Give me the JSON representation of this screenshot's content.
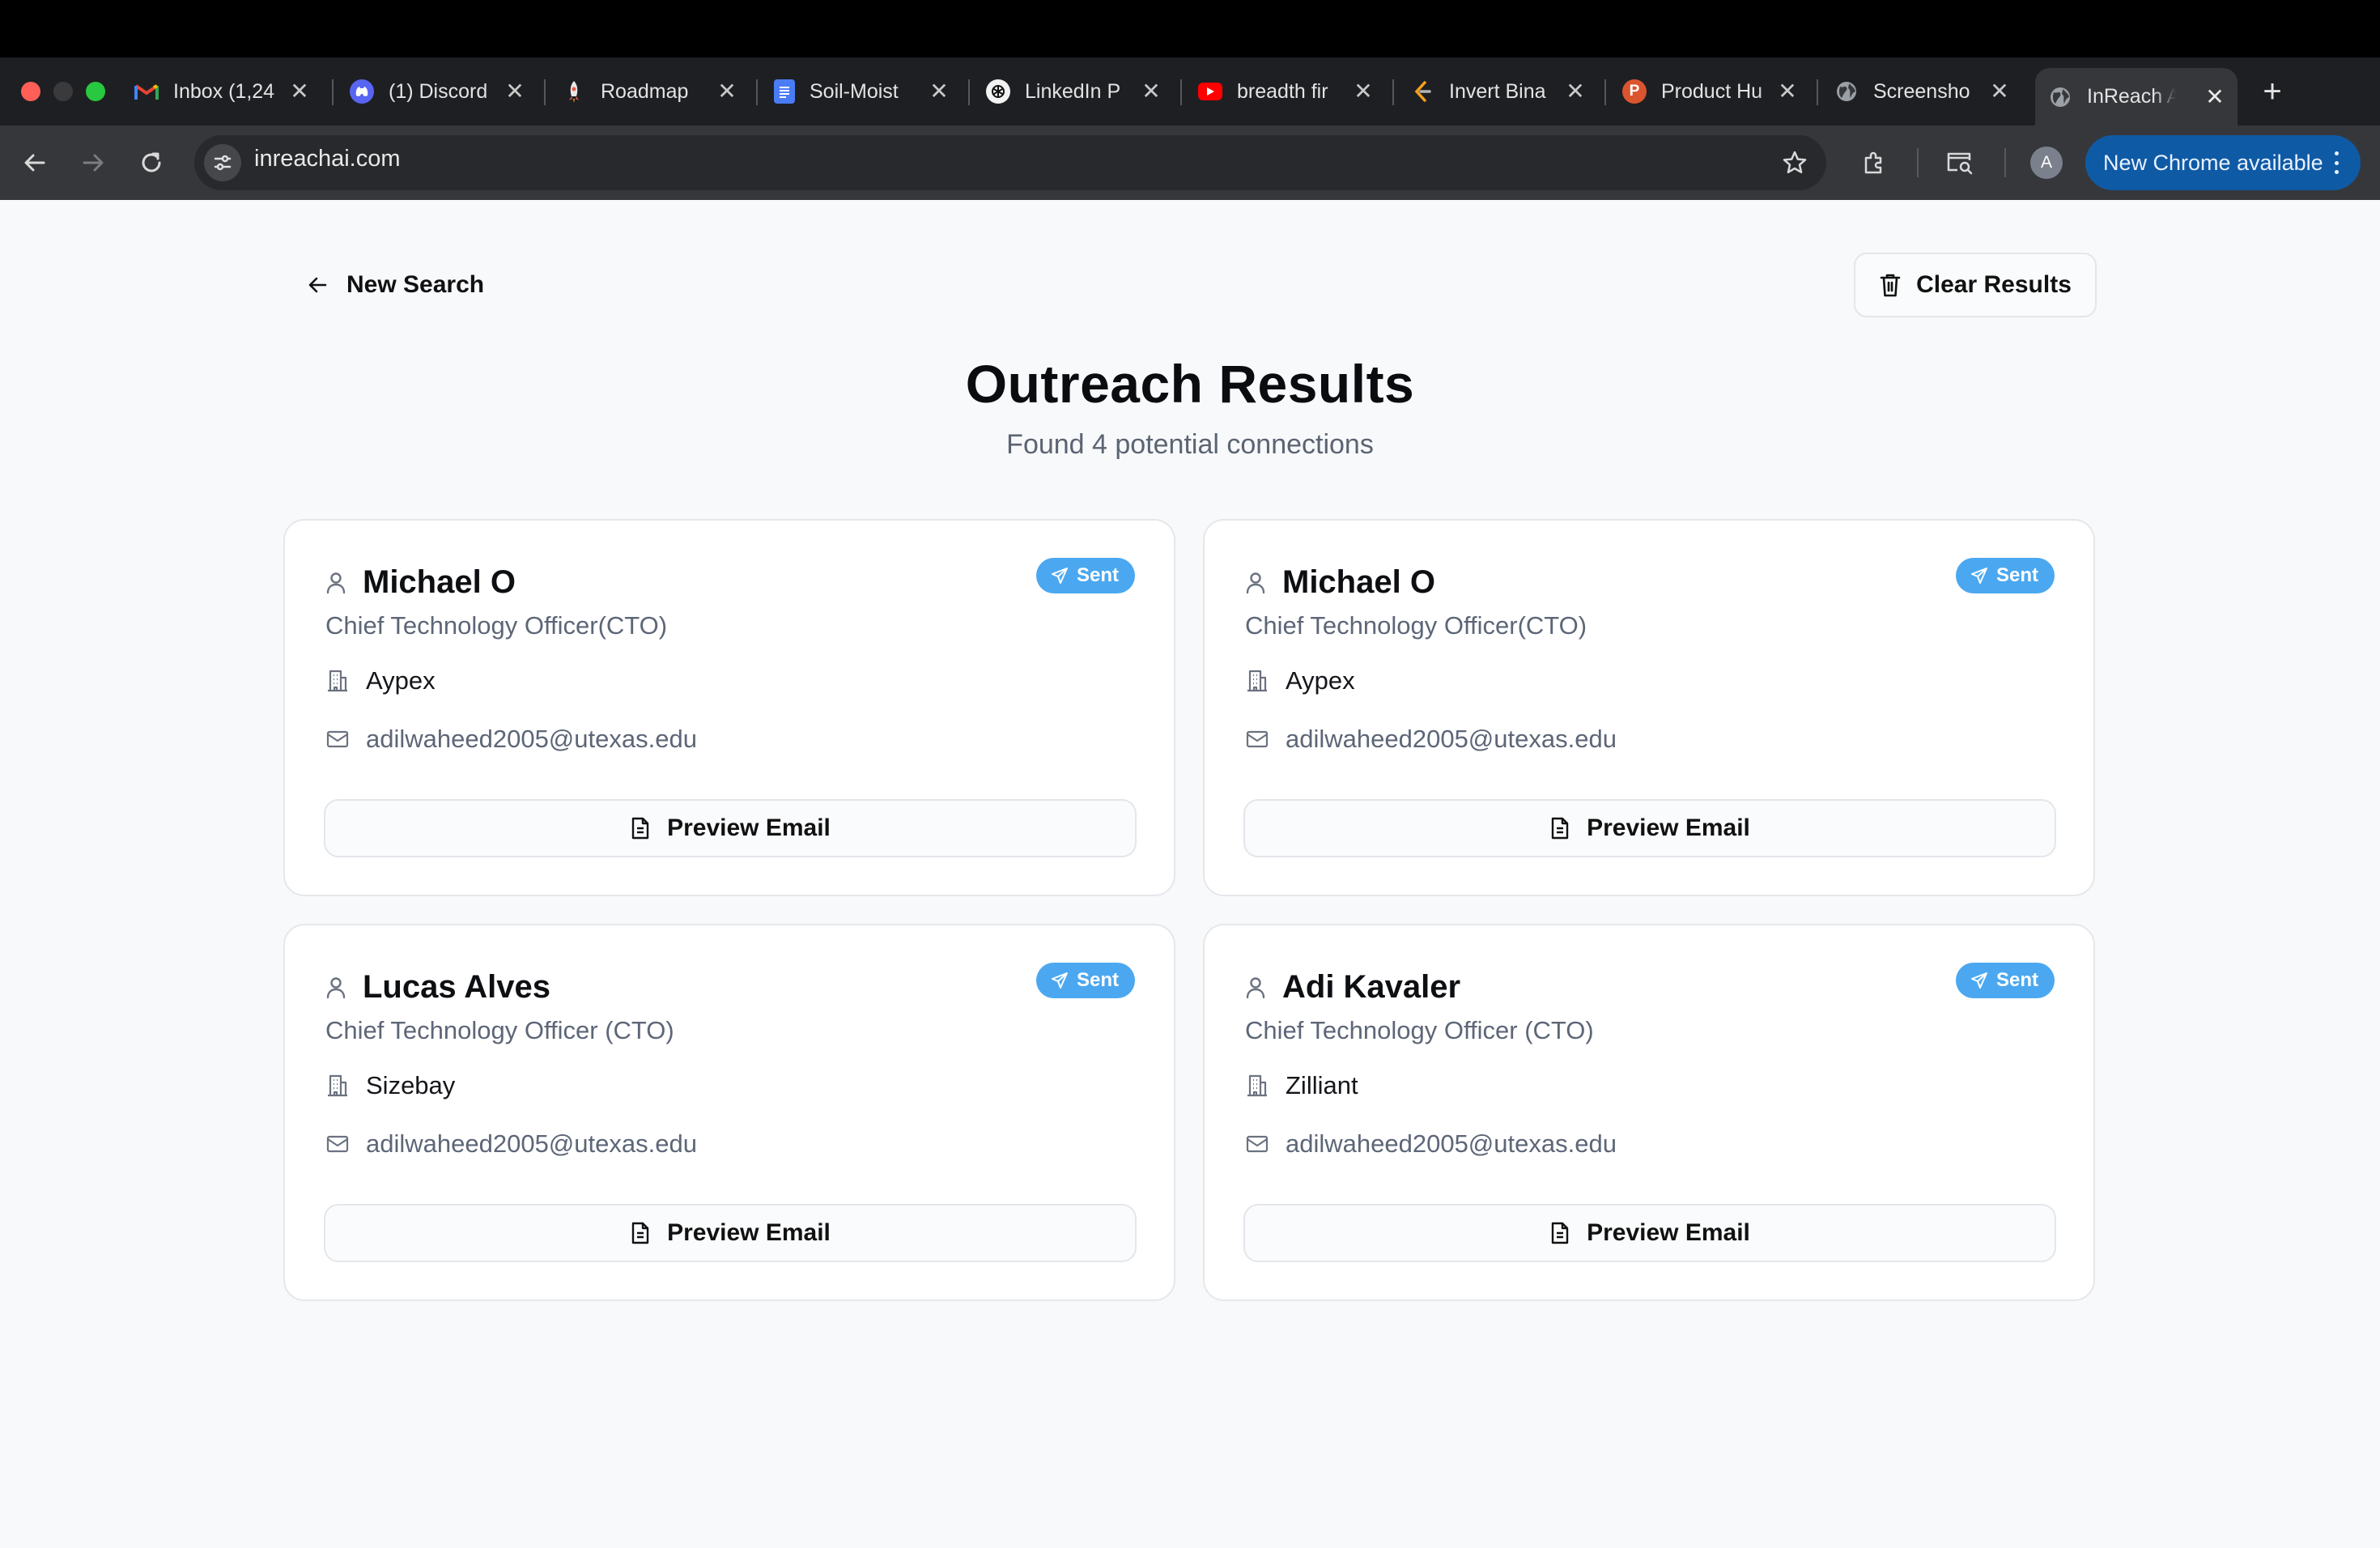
{
  "browser": {
    "tabs": [
      {
        "title": "Inbox (1,24",
        "favicon": "gmail-icon"
      },
      {
        "title": "(1) Discord",
        "favicon": "discord-icon"
      },
      {
        "title": "Roadmap",
        "favicon": "rocket-icon"
      },
      {
        "title": "Soil-Moist",
        "favicon": "docs-icon"
      },
      {
        "title": "LinkedIn P",
        "favicon": "openai-icon"
      },
      {
        "title": "breadth fir",
        "favicon": "youtube-icon"
      },
      {
        "title": "Invert Bina",
        "favicon": "leetcode-icon"
      },
      {
        "title": "Product Hu",
        "favicon": "producthunt-icon"
      },
      {
        "title": "Screensho",
        "favicon": "globe-icon"
      },
      {
        "title": "InReach AI",
        "favicon": "globe-icon",
        "active": true
      }
    ],
    "url": "inreachai.com",
    "profile_initial": "A",
    "update_label": "New Chrome available"
  },
  "page": {
    "back_label": "New Search",
    "clear_label": "Clear Results",
    "title": "Outreach Results",
    "subtitle": "Found 4 potential connections",
    "accent_color": "#4ba8f0"
  },
  "results": [
    {
      "name": "Michael O",
      "role": "Chief Technology Officer(CTO)",
      "company": "Aypex",
      "email": "adilwaheed2005@utexas.edu",
      "status": "Sent",
      "action": "Preview Email"
    },
    {
      "name": "Michael O",
      "role": "Chief Technology Officer(CTO)",
      "company": "Aypex",
      "email": "adilwaheed2005@utexas.edu",
      "status": "Sent",
      "action": "Preview Email"
    },
    {
      "name": "Lucas Alves",
      "role": "Chief Technology Officer (CTO)",
      "company": "Sizebay",
      "email": "adilwaheed2005@utexas.edu",
      "status": "Sent",
      "action": "Preview Email"
    },
    {
      "name": "Adi Kavaler",
      "role": "Chief Technology Officer (CTO)",
      "company": "Zilliant",
      "email": "adilwaheed2005@utexas.edu",
      "status": "Sent",
      "action": "Preview Email"
    }
  ]
}
